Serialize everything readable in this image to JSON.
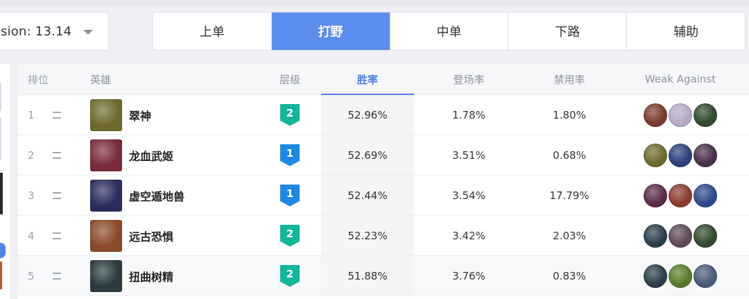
{
  "version": {
    "label": "sion: 13.14"
  },
  "tabs": [
    {
      "label": "上单",
      "active": false
    },
    {
      "label": "打野",
      "active": true
    },
    {
      "label": "中单",
      "active": false
    },
    {
      "label": "下路",
      "active": false
    },
    {
      "label": "辅助",
      "active": false
    }
  ],
  "table": {
    "headers": {
      "rank": "排位",
      "hero": "英雄",
      "tier": "层级",
      "win": "胜率",
      "pick": "登场率",
      "ban": "禁用率",
      "weak": "Weak Against"
    },
    "rows": [
      {
        "rank": "1",
        "name": "翠神",
        "tier": "2",
        "win": "52.96%",
        "pick": "1.78%",
        "ban": "1.80%",
        "avatar": "#6e6a2e",
        "weak": [
          "#7a3a2e",
          "#b7a9c6",
          "#2f4a2c"
        ]
      },
      {
        "rank": "2",
        "name": "龙血武姬",
        "tier": "1",
        "win": "52.69%",
        "pick": "3.51%",
        "ban": "0.68%",
        "avatar": "#7a2b3a",
        "weak": [
          "#6e6a2e",
          "#2b3f7a",
          "#4a2f4a"
        ]
      },
      {
        "rank": "3",
        "name": "虚空遁地兽",
        "tier": "1",
        "win": "52.44%",
        "pick": "3.54%",
        "ban": "17.79%",
        "avatar": "#2a2c5e",
        "weak": [
          "#5a2a4a",
          "#8b3a2e",
          "#2b4a8a"
        ]
      },
      {
        "rank": "4",
        "name": "远古恐惧",
        "tier": "2",
        "win": "52.23%",
        "pick": "3.42%",
        "ban": "2.03%",
        "avatar": "#8a4a2a",
        "weak": [
          "#2a3e4a",
          "#5e4a5a",
          "#2f4a2c"
        ]
      },
      {
        "rank": "5",
        "name": "扭曲树精",
        "tier": "2",
        "win": "51.88%",
        "pick": "3.76%",
        "ban": "0.83%",
        "avatar": "#2a3a3e",
        "weak": [
          "#2a3e4a",
          "#5a7a2a",
          "#4a5a7a"
        ]
      }
    ]
  }
}
